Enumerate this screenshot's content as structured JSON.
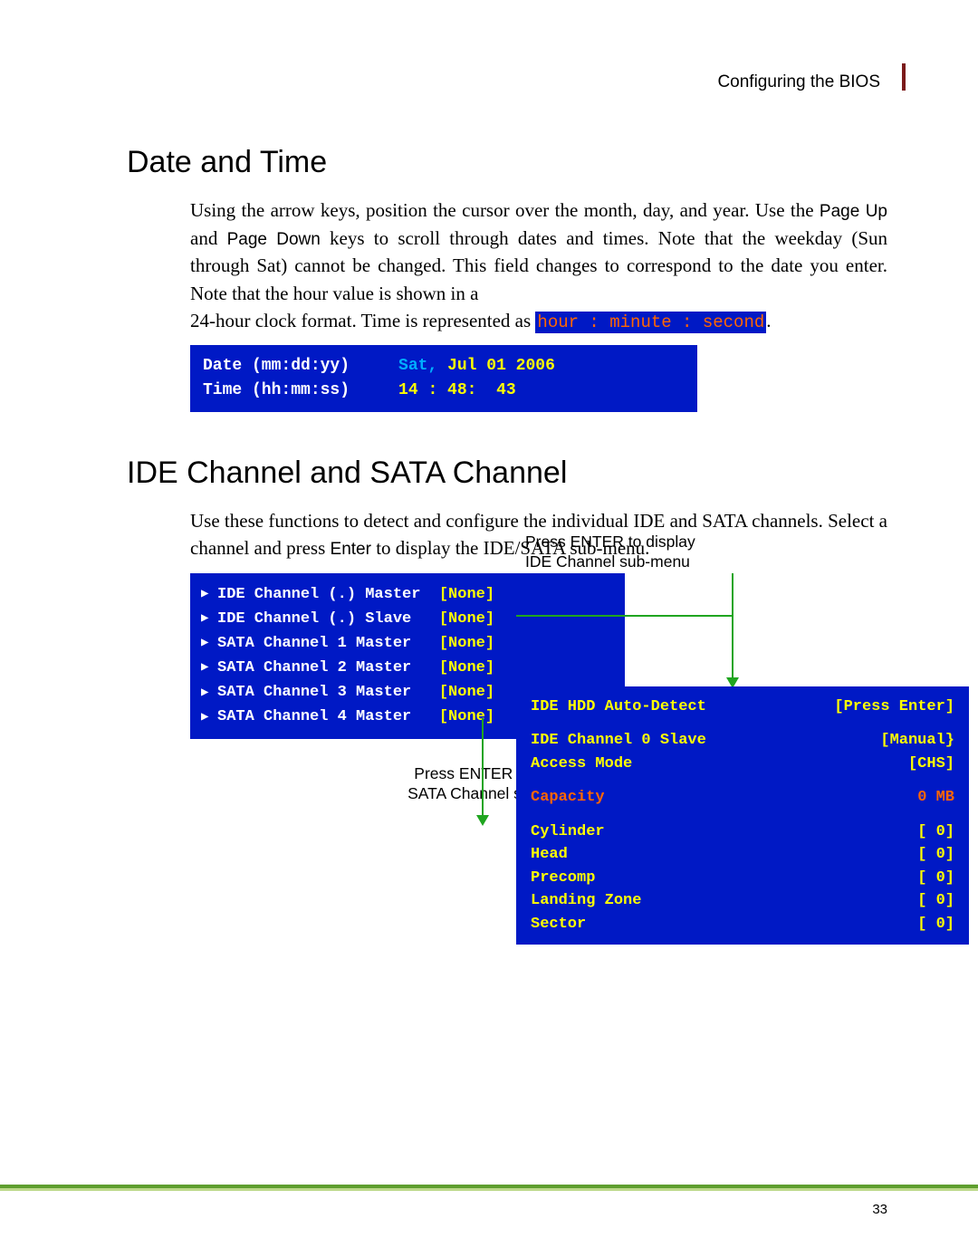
{
  "header": {
    "text": "Configuring the BIOS"
  },
  "section1": {
    "title": "Date and Time",
    "para1a": "Using the arrow keys, position the cursor over the month, day, and year. Use the ",
    "key1": "Page Up",
    "para1b": " and ",
    "key2": "Page Down",
    "para1c": " keys to scroll through dates and times. Note that the weekday (Sun through Sat) cannot be changed. This field changes to correspond to the date you enter. Note that the hour value is shown in a",
    "para2a": "24-hour clock format. Time is represented as ",
    "hl": "hour : minute : second",
    "period": ".",
    "bios": {
      "date_label": "Date (mm:dd:yy)     ",
      "date_day": "Sat, ",
      "date_val": "Jul 01 2006",
      "time_label": "Time (hh:mm:ss)     ",
      "time_val": "14 : 48:  43"
    }
  },
  "section2": {
    "title": "IDE Channel and SATA Channel",
    "para_a": "Use these functions to detect and configure the individual IDE and SATA channels. Select a channel and press ",
    "key": "Enter",
    "para_b": " to display the IDE/SATA sub-menu.",
    "caption1a": "Press ENTER to display",
    "caption1b": "IDE Channel sub-menu",
    "caption2a": "Press ENTER to display",
    "caption2b": "SATA Channel sub-menu",
    "channels": [
      {
        "label": "IDE Channel (.) Master  ",
        "val": "[None]"
      },
      {
        "label": "IDE Channel (.) Slave   ",
        "val": "[None]"
      },
      {
        "label": "SATA Channel 1 Master   ",
        "val": "[None]"
      },
      {
        "label": "SATA Channel 2 Master   ",
        "val": "[None]"
      },
      {
        "label": "SATA Channel 3 Master   ",
        "val": "[None]"
      },
      {
        "label": "SATA Channel 4 Master   ",
        "val": "[None]"
      }
    ],
    "submenu": {
      "r1l": "IDE HDD Auto-Detect",
      "r1v": "[Press Enter]",
      "r2l": "IDE Channel 0 Slave",
      "r2v": "[Manual}",
      "r3l": "Access Mode",
      "r3v": "[CHS]",
      "r4l": "Capacity",
      "r4v": "   0 MB",
      "r5l": "Cylinder",
      "r5v": "[    0]",
      "r6l": "Head",
      "r6v": "[    0]",
      "r7l": "Precomp",
      "r7v": "[    0]",
      "r8l": "Landing Zone",
      "r8v": "[    0]",
      "r9l": "Sector",
      "r9v": "[    0]"
    }
  },
  "page_number": "33"
}
